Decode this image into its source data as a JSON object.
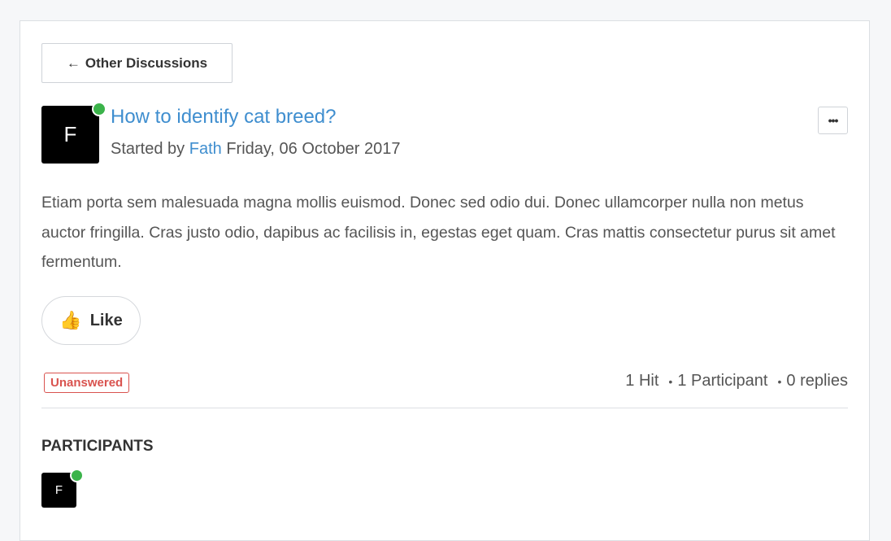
{
  "back_button": {
    "arrow": "←",
    "label": "Other Discussions"
  },
  "discussion": {
    "avatar_initial": "F",
    "title": "How to identify cat breed?",
    "started_by_label": "Started by",
    "author": "Fath",
    "date": "Friday, 06 October 2017",
    "more_label": "•••",
    "body": "Etiam porta sem malesuada magna mollis euismod. Donec sed odio dui. Donec ullamcorper nulla non metus auctor fringilla. Cras justo odio, dapibus ac facilisis in, egestas eget quam. Cras mattis consectetur purus sit amet fermentum."
  },
  "like_button": {
    "icon": "👍",
    "label": "Like"
  },
  "status_badge": "Unanswered",
  "stats": {
    "hits": "1 Hit",
    "participants": "1 Participant",
    "replies": "0 replies",
    "separator": "•"
  },
  "participants": {
    "heading": "PARTICIPANTS",
    "items": [
      {
        "initial": "F"
      }
    ]
  },
  "colors": {
    "link": "#3f8ecf",
    "online": "#3bb34a",
    "unanswered": "#d9534f"
  }
}
